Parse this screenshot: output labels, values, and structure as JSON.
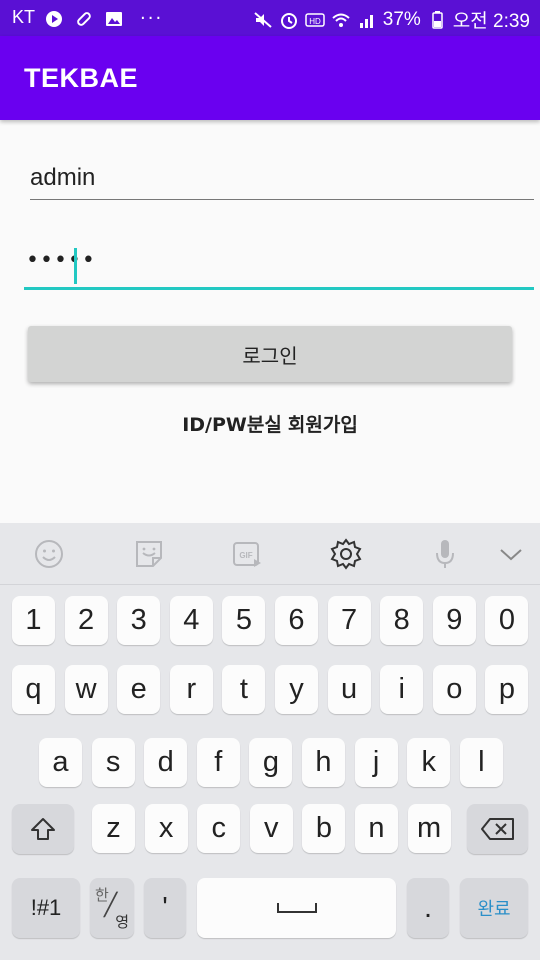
{
  "status_bar": {
    "carrier": "KT",
    "dots": "···",
    "battery": "37%",
    "time": "오전 2:39",
    "icons": [
      "youtube-icon",
      "link-icon",
      "gallery-icon",
      "mute-icon",
      "alarm-icon",
      "hd-icon",
      "wifi-icon",
      "signal-icon",
      "battery-icon"
    ]
  },
  "app_bar": {
    "title": "TEKBAE"
  },
  "form": {
    "id_value": "admin",
    "password_value": "•••••",
    "login_button": "로그인",
    "link_id_pw": "ID/PW분실",
    "link_signup": "회원가입"
  },
  "keyboard": {
    "toolbar_icons": [
      "emoji-icon",
      "sticker-icon",
      "gif-icon",
      "settings-icon",
      "mic-icon",
      "collapse-icon"
    ],
    "row_numbers": [
      "1",
      "2",
      "3",
      "4",
      "5",
      "6",
      "7",
      "8",
      "9",
      "0"
    ],
    "row1": [
      "q",
      "w",
      "e",
      "r",
      "t",
      "y",
      "u",
      "i",
      "o",
      "p"
    ],
    "row2": [
      "a",
      "s",
      "d",
      "f",
      "g",
      "h",
      "j",
      "k",
      "l"
    ],
    "row3": [
      "z",
      "x",
      "c",
      "v",
      "b",
      "n",
      "m"
    ],
    "symbols_key": "!#1",
    "lang_key_top": "한",
    "lang_key_bottom": "영",
    "apostrophe_key": "'",
    "period_key": ".",
    "done_key": "완료"
  }
}
